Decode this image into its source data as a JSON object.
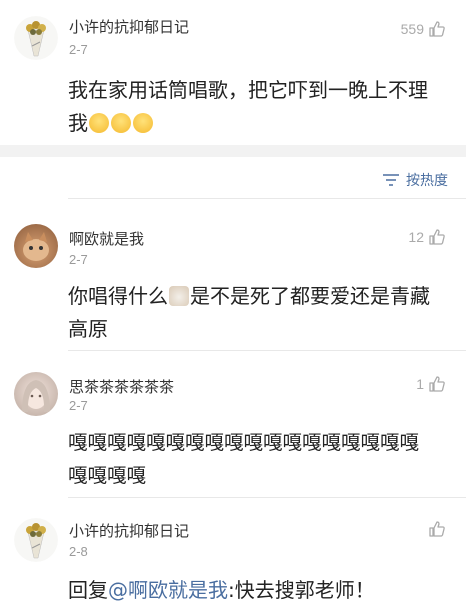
{
  "post": {
    "author": "小许的抗抑郁日记",
    "date": "2-7",
    "likes": "559",
    "text_line1": "我在家用话筒唱歌，把它吓到一晚上不理",
    "text_line2": "我"
  },
  "sort": {
    "label": "按热度"
  },
  "comments": [
    {
      "author": "啊欧就是我",
      "date": "2-7",
      "likes": "12",
      "text_before": "你唱得什么",
      "text_after": "是不是死了都要爱还是青藏",
      "text_line2": "高原"
    },
    {
      "author": "思茶茶茶茶茶茶",
      "date": "2-7",
      "likes": "1",
      "text_line1": "嘎嘎嘎嘎嘎嘎嘎嘎嘎嘎嘎嘎嘎嘎嘎嘎嘎嘎",
      "text_line2": "嘎嘎嘎嘎"
    },
    {
      "author": "小许的抗抑郁日记",
      "date": "2-8",
      "likes": "",
      "reply_prefix": "回复",
      "mention": "@啊欧就是我",
      "reply_text": ":快去搜郭老师！"
    }
  ]
}
